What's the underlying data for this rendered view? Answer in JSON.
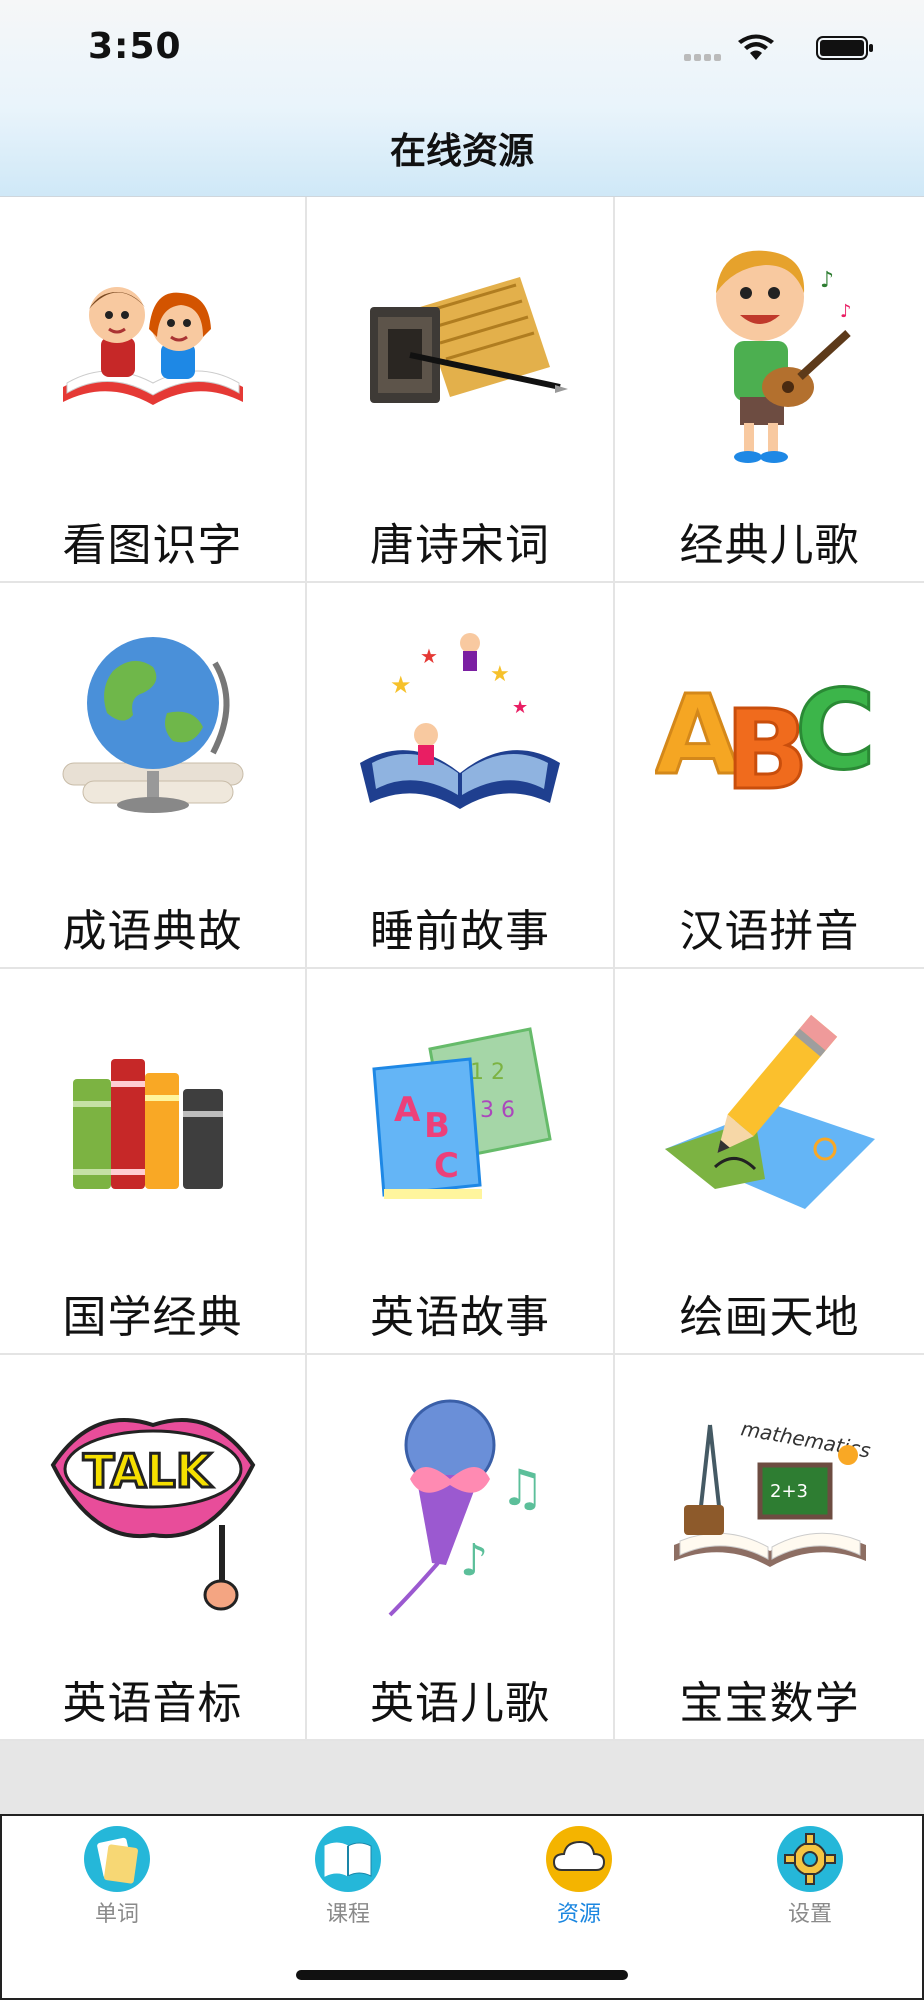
{
  "status_bar": {
    "time": "3:50"
  },
  "nav": {
    "title": "在线资源"
  },
  "tiles": [
    {
      "label": "看图识字",
      "icon": "kids-reading-book-icon"
    },
    {
      "label": "唐诗宋词",
      "icon": "scroll-and-brush-icon"
    },
    {
      "label": "经典儿歌",
      "icon": "boy-with-guitar-icon"
    },
    {
      "label": "成语典故",
      "icon": "globe-with-scrolls-icon"
    },
    {
      "label": "睡前故事",
      "icon": "storybook-icon"
    },
    {
      "label": "汉语拼音",
      "icon": "abc-letters-icon"
    },
    {
      "label": "国学经典",
      "icon": "books-icon"
    },
    {
      "label": "英语故事",
      "icon": "abc-book-icon"
    },
    {
      "label": "绘画天地",
      "icon": "pencil-drawing-icon"
    },
    {
      "label": "英语音标",
      "icon": "talk-mouth-sign-icon"
    },
    {
      "label": "英语儿歌",
      "icon": "microphone-music-icon"
    },
    {
      "label": "宝宝数学",
      "icon": "math-book-icon"
    }
  ],
  "tabs": [
    {
      "label": "单词",
      "icon": "note-card-icon",
      "active": false,
      "color": "#25b7d9"
    },
    {
      "label": "课程",
      "icon": "open-book-icon",
      "active": false,
      "color": "#25b7d9"
    },
    {
      "label": "资源",
      "icon": "cloud-icon",
      "active": true,
      "color": "#f4b400"
    },
    {
      "label": "设置",
      "icon": "gear-icon",
      "active": false,
      "color": "#25b7d9"
    }
  ],
  "colors": {
    "active_tab_text": "#1a86e0",
    "inactive_tab_text": "#8a8a8a"
  }
}
